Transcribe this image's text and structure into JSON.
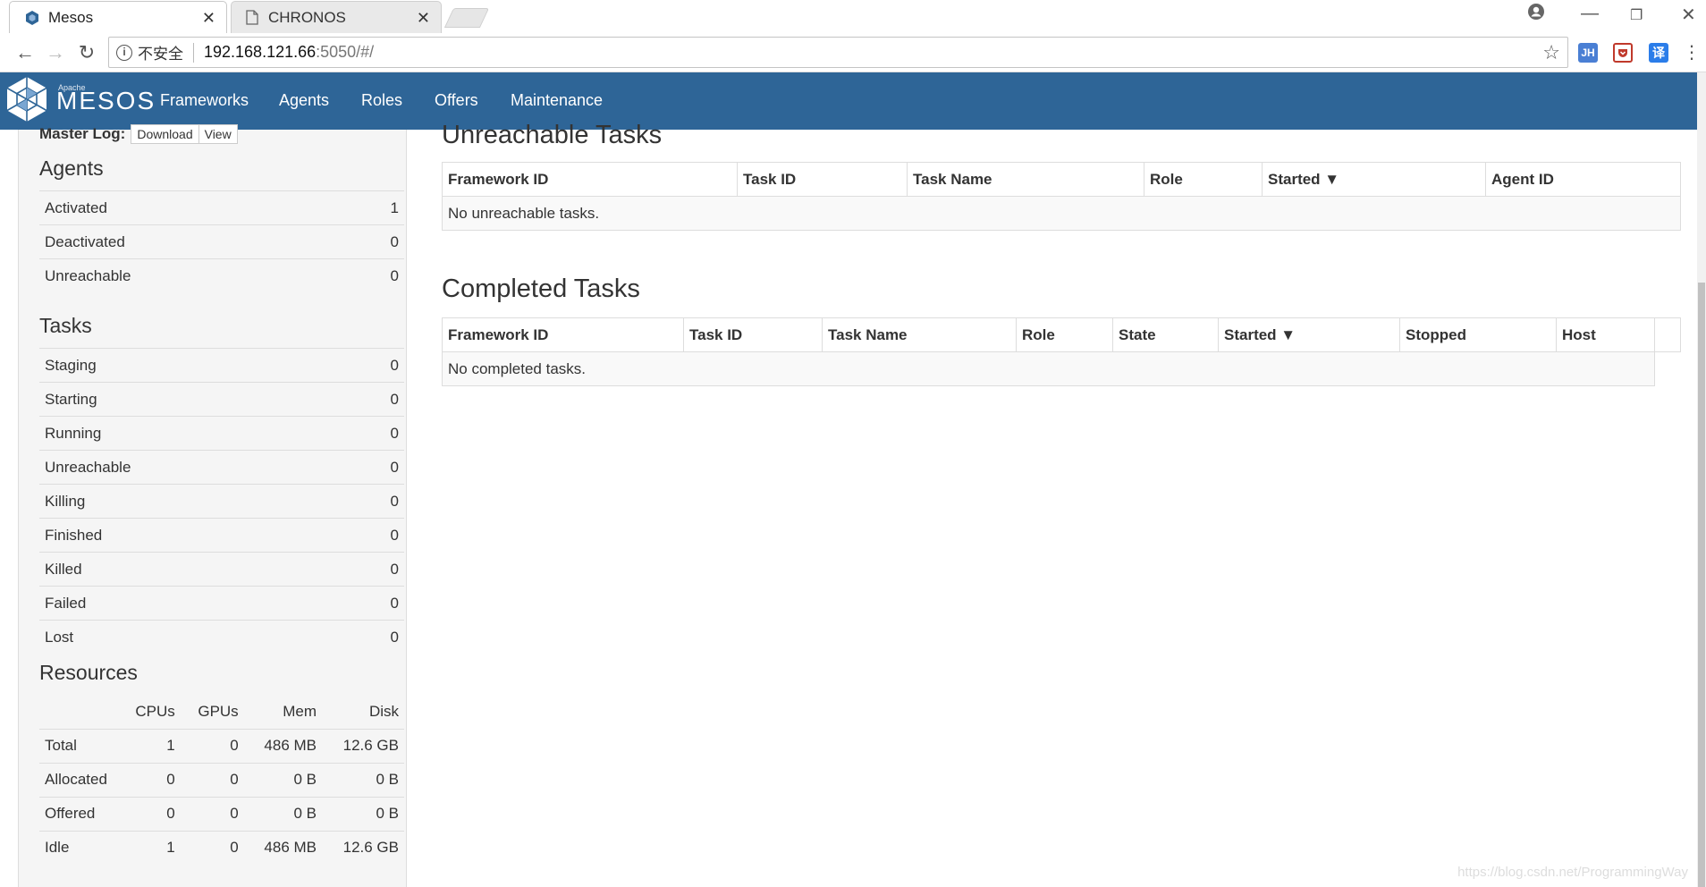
{
  "browser": {
    "tabs": [
      {
        "title": "Mesos",
        "active": true
      },
      {
        "title": "CHRONOS",
        "active": false
      }
    ],
    "address": {
      "security_label": "不安全",
      "host": "192.168.121.66",
      "path": ":5050/#/"
    },
    "extensions": [
      "JH",
      "译"
    ]
  },
  "navbar": {
    "brand_small": "Apache",
    "brand": "MESOS",
    "links": [
      "Frameworks",
      "Agents",
      "Roles",
      "Offers",
      "Maintenance"
    ]
  },
  "sidebar": {
    "master_log_label": "Master Log:",
    "download_label": "Download",
    "view_label": "View",
    "agents": {
      "title": "Agents",
      "rows": [
        {
          "label": "Activated",
          "value": "1"
        },
        {
          "label": "Deactivated",
          "value": "0"
        },
        {
          "label": "Unreachable",
          "value": "0"
        }
      ]
    },
    "tasks": {
      "title": "Tasks",
      "rows": [
        {
          "label": "Staging",
          "value": "0"
        },
        {
          "label": "Starting",
          "value": "0"
        },
        {
          "label": "Running",
          "value": "0"
        },
        {
          "label": "Unreachable",
          "value": "0"
        },
        {
          "label": "Killing",
          "value": "0"
        },
        {
          "label": "Finished",
          "value": "0"
        },
        {
          "label": "Killed",
          "value": "0"
        },
        {
          "label": "Failed",
          "value": "0"
        },
        {
          "label": "Lost",
          "value": "0"
        }
      ]
    },
    "resources": {
      "title": "Resources",
      "columns": [
        "",
        "CPUs",
        "GPUs",
        "Mem",
        "Disk"
      ],
      "rows": [
        [
          "Total",
          "1",
          "0",
          "486 MB",
          "12.6 GB"
        ],
        [
          "Allocated",
          "0",
          "0",
          "0 B",
          "0 B"
        ],
        [
          "Offered",
          "0",
          "0",
          "0 B",
          "0 B"
        ],
        [
          "Idle",
          "1",
          "0",
          "486 MB",
          "12.6 GB"
        ]
      ]
    }
  },
  "unreachable": {
    "title": "Unreachable Tasks",
    "columns": [
      "Framework ID",
      "Task ID",
      "Task Name",
      "Role",
      "Started ▼",
      "Agent ID"
    ],
    "empty": "No unreachable tasks."
  },
  "completed": {
    "title": "Completed Tasks",
    "columns": [
      "Framework ID",
      "Task ID",
      "Task Name",
      "Role",
      "State",
      "Started ▼",
      "Stopped",
      "Host",
      ""
    ],
    "empty": "No completed tasks."
  },
  "watermark": "https://blog.csdn.net/ProgrammingWay"
}
